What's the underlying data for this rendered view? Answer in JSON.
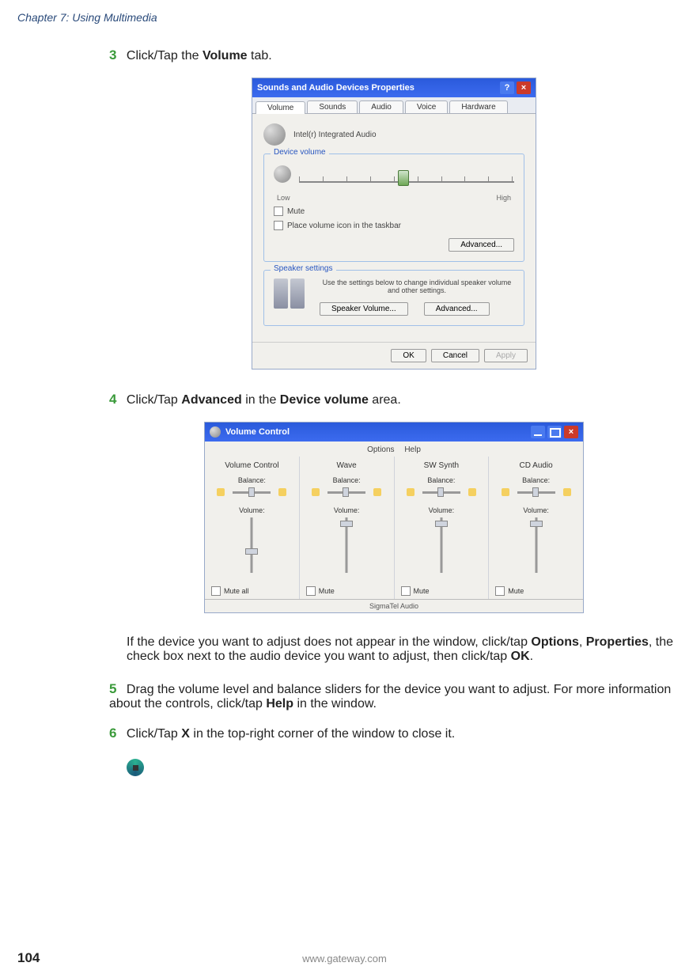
{
  "chapter": "Chapter 7: Using Multimedia",
  "steps": {
    "s3": {
      "num": "3",
      "pre": "Click/Tap the ",
      "b1": "Volume",
      "post": " tab."
    },
    "s4": {
      "num": "4",
      "pre": "Click/Tap ",
      "b1": "Advanced",
      "mid": " in the ",
      "b2": "Device volume",
      "post": " area."
    },
    "note": {
      "l1": "If the device you want to adjust does not appear in the window, click/tap ",
      "b1": "Options",
      "c1": ", ",
      "b2": "Properties",
      "l2": ", the check box next to the audio device you want to adjust, then click/tap ",
      "b3": "OK",
      "l3": "."
    },
    "s5": {
      "num": "5",
      "l1": "Drag the volume level and balance sliders for the device you want to adjust. For more information about the controls, click/tap ",
      "b1": "Help",
      "l2": " in the window."
    },
    "s6": {
      "num": "6",
      "pre": "Click/Tap ",
      "b1": "X",
      "post": " in the top-right corner of the window to close it."
    }
  },
  "dialog1": {
    "title": "Sounds and Audio Devices Properties",
    "tabs": [
      "Volume",
      "Sounds",
      "Audio",
      "Voice",
      "Hardware"
    ],
    "device": "Intel(r) Integrated Audio",
    "group1": "Device volume",
    "low": "Low",
    "high": "High",
    "mute": "Mute",
    "taskbar": "Place volume icon in the taskbar",
    "advanced": "Advanced...",
    "group2": "Speaker settings",
    "spk_text": "Use the settings below to change individual speaker volume and other settings.",
    "spk_vol": "Speaker Volume...",
    "btns": {
      "ok": "OK",
      "cancel": "Cancel",
      "apply": "Apply"
    }
  },
  "dialog2": {
    "title": "Volume Control",
    "menu": {
      "options": "Options",
      "help": "Help"
    },
    "cols": [
      {
        "title": "Volume Control",
        "bal": "Balance:",
        "vol": "Volume:",
        "mute": "Mute all",
        "thumb": 55
      },
      {
        "title": "Wave",
        "bal": "Balance:",
        "vol": "Volume:",
        "mute": "Mute",
        "thumb": 5
      },
      {
        "title": "SW Synth",
        "bal": "Balance:",
        "vol": "Volume:",
        "mute": "Mute",
        "thumb": 5
      },
      {
        "title": "CD Audio",
        "bal": "Balance:",
        "vol": "Volume:",
        "mute": "Mute",
        "thumb": 5
      }
    ],
    "status": "SigmaTel Audio"
  },
  "page_num": "104",
  "footer": "www.gateway.com"
}
